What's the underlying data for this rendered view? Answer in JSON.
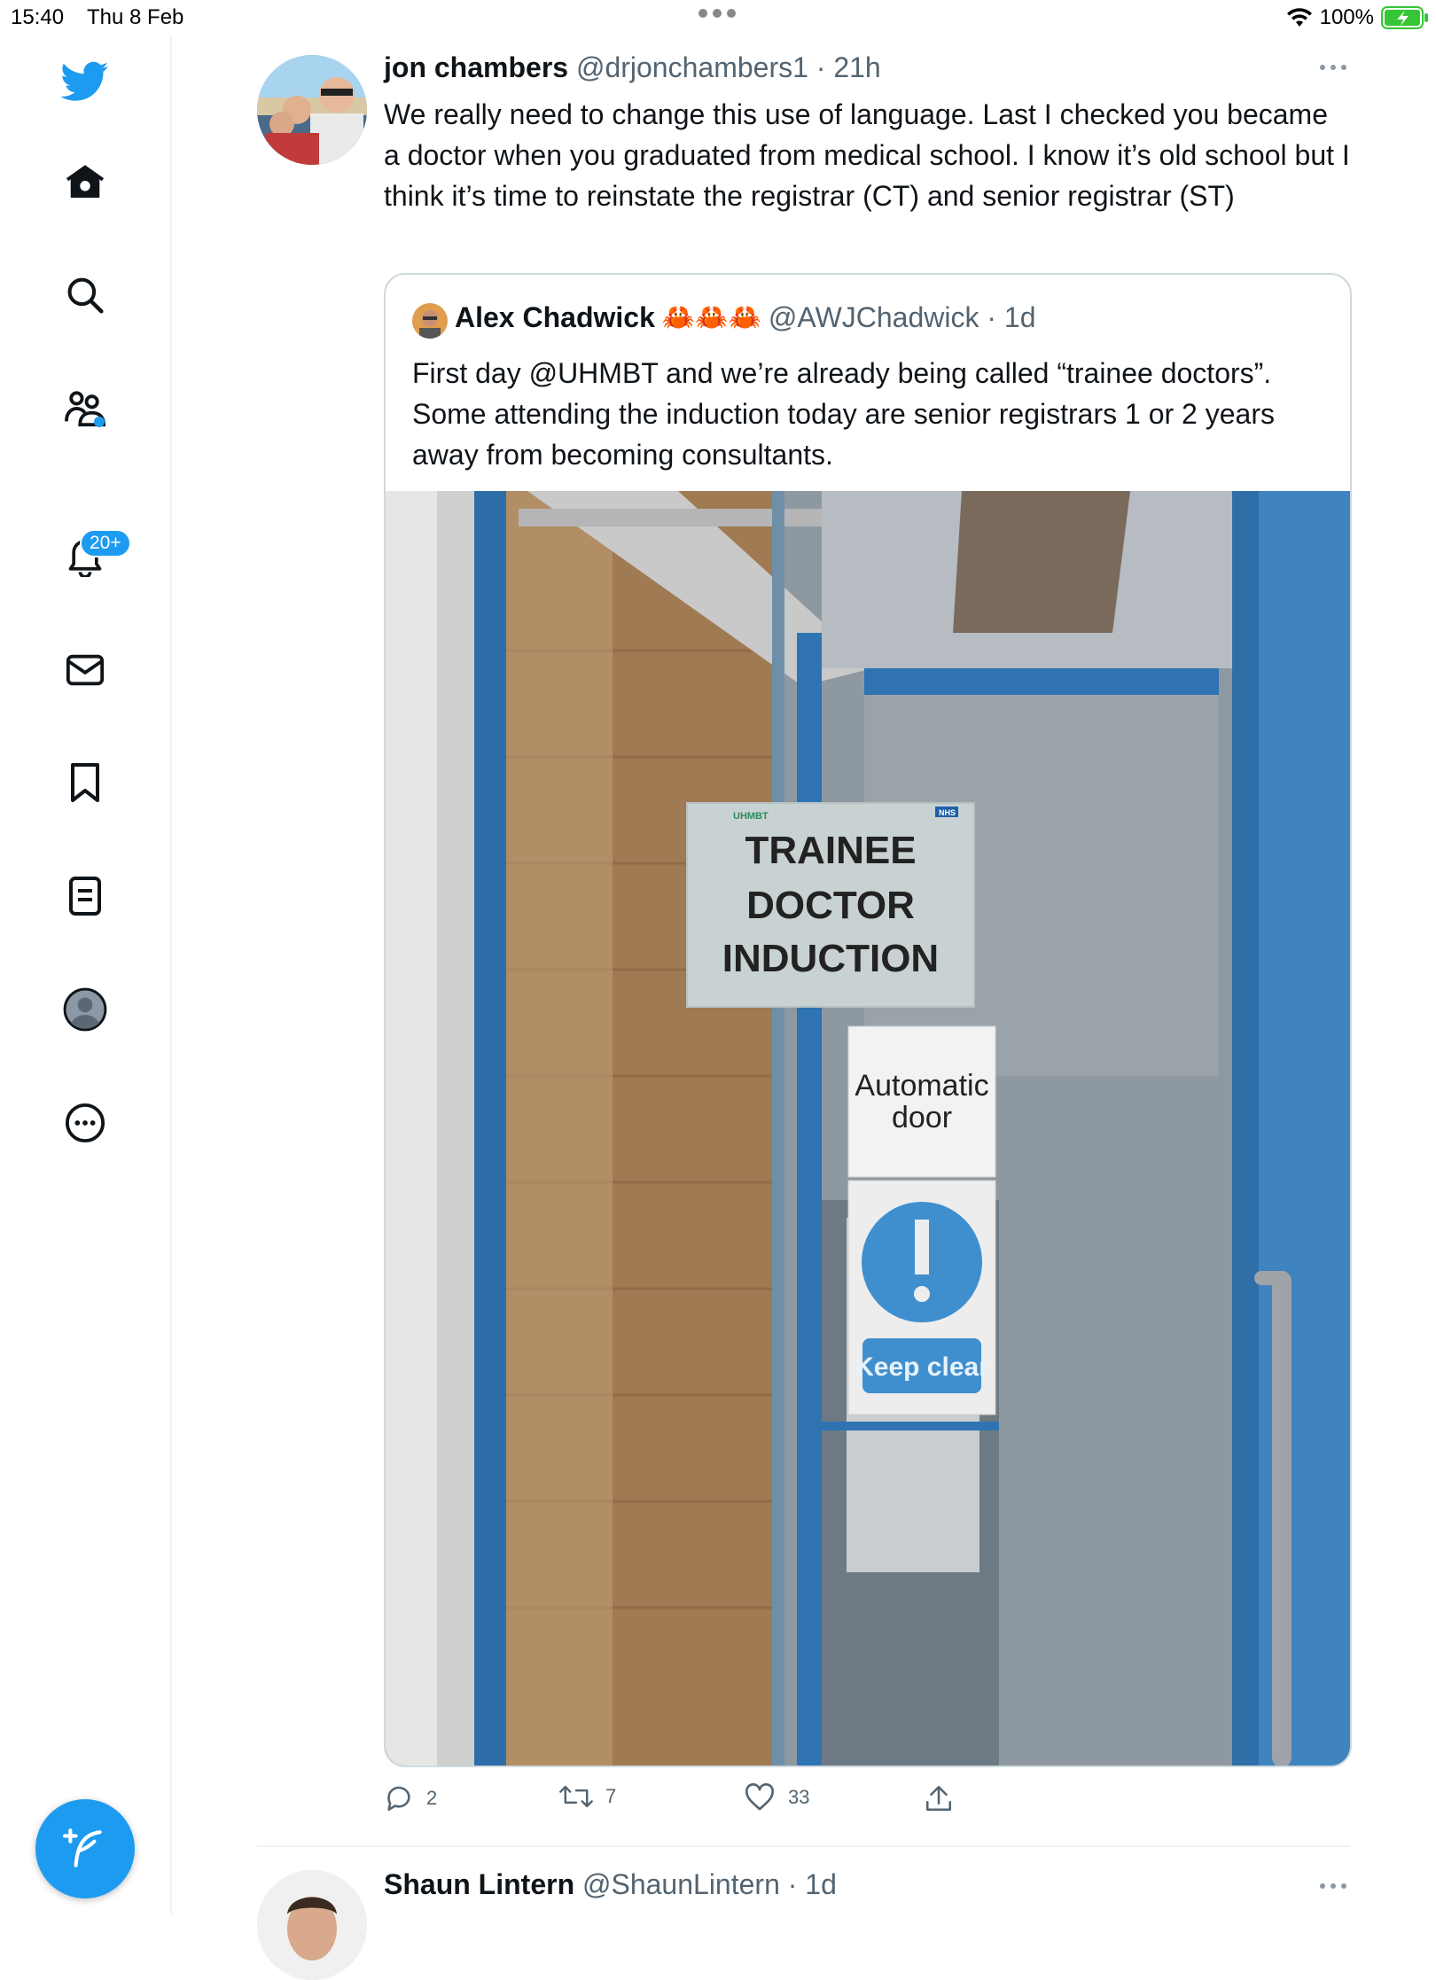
{
  "status_bar": {
    "time": "15:40",
    "date": "Thu 8 Feb",
    "battery": "100%"
  },
  "sidebar": {
    "items": [
      {
        "name": "twitter-logo-icon"
      },
      {
        "name": "home-icon"
      },
      {
        "name": "search-icon"
      },
      {
        "name": "communities-icon"
      },
      {
        "name": "notifications-icon"
      },
      {
        "name": "messages-icon"
      },
      {
        "name": "bookmarks-icon"
      },
      {
        "name": "lists-icon"
      },
      {
        "name": "profile-icon"
      },
      {
        "name": "more-icon"
      }
    ],
    "notifications_badge": "20+",
    "compose_icon": "compose-icon"
  },
  "tweet": {
    "name": "jon chambers",
    "handle": "@drjonchambers1",
    "sep": " · ",
    "time": "21h",
    "text": "We really need to change this use of language. Last I checked you became a doctor when you graduated from medical school. I know it’s old school but I think it’s time to reinstate the registrar (CT) and senior registrar (ST)",
    "quote": {
      "name": "Alex Chadwick",
      "emoji": "🦀🦀🦀",
      "handle": "@AWJChadwick",
      "sep": " · ",
      "time": "1d",
      "text": "First day @UHMBT and we’re already being called “trainee doctors”. Some attending the induction today are senior registrars 1 or 2 years away from becoming consultants.",
      "image": {
        "sign_logo": "UHMBT",
        "sign_nhs": "NHS",
        "sign_lines": [
          "TRAINEE",
          "DOCTOR",
          "INDUCTION"
        ],
        "door_sign": [
          "Automatic",
          "door"
        ],
        "keep_clear": "Keep clear"
      }
    },
    "actions": {
      "replies": "2",
      "retweets": "7",
      "likes": "33"
    }
  },
  "next_tweet": {
    "name": "Shaun Lintern",
    "handle": "@ShaunLintern",
    "sep": " · ",
    "time": "1d"
  },
  "colors": {
    "accent": "#1d9bf0",
    "secondary_text": "#536471",
    "border": "#cfd9de"
  }
}
